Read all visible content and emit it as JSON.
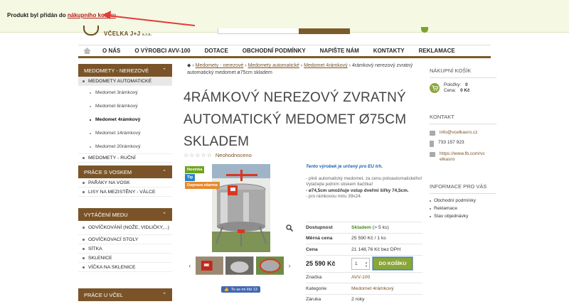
{
  "notice": {
    "text": "Produkt byl přidán do ",
    "link": "nákupního košíku"
  },
  "header": {
    "logo": "VČELKA J+J",
    "logo_suffix": "s.r.o."
  },
  "nav": [
    "O NÁS",
    "O VÝROBCI AVV-100",
    "DOTACE",
    "OBCHODNÍ PODMÍNKY",
    "NAPIŠTE NÁM",
    "KONTAKTY",
    "REKLAMACE"
  ],
  "sidebar": {
    "medomety": {
      "title": "MEDOMETY - NEREZOVÉ",
      "active": "MEDOMETY AUTOMATICKÉ",
      "subitems": [
        "Medomet 3rámkový",
        "Medomet 6rámkový",
        "Medomet 4rámkový",
        "Medomet 14rámkový",
        "Medomet 20rámkový"
      ],
      "after": "MEDOMETY - RUČNÍ"
    },
    "vosk": {
      "title": "PRÁCE S VOSKEM",
      "items": [
        "PAŘÁKY NA VOSK",
        "LISY NA MEZISTĚNY - VÁLCE"
      ]
    },
    "med": {
      "title": "VYTÁČENÍ MEDU",
      "items": [
        "ODVÍČKOVÁNÍ (NOŽE, VIDLIČKY,...)",
        "ODVÍČKOVACÍ STOLY",
        "SÍTKA",
        "SKLENICE",
        "VÍČKA NA SKLENICE"
      ]
    },
    "vcely": {
      "title": "PRÁCE U VČEL"
    }
  },
  "breadcrumb": {
    "b1": "Medomety - nerezové",
    "b2": "Medomety automatické",
    "b3": "Medomet 4rámkový",
    "current": "4rámkový nerezový zvratný automatický medomet ø75cm skladem"
  },
  "product": {
    "title": "4RÁMKOVÝ NEREZOVÝ ZVRATNÝ AUTOMATICKÝ MEDOMET Ø75CM SKLADEM",
    "stars": "☆☆☆☆☆",
    "rating": "Neohodnoceno",
    "badges": {
      "novinka": "Novinka",
      "tip": "Tip",
      "doprava": "Doprava zdarma"
    },
    "eu": "Tento výrobek je určený pro EU trh.",
    "desc1": "- plně automatický medomet, za cenu poloautomatického! Vytáčejte jedním stiskem tlačítka!",
    "desc2": "- ø74,5cm umožňuje vstup dveřmi šířky 74,5cm.",
    "desc3": "- pro rámkovou míru 39x24.",
    "fb": "To se mi líbí 13",
    "params": {
      "dostupnost_k": "Dostupnost",
      "dostupnost_v": "Skladem",
      "dostupnost_extra": " (> 5 ks)",
      "merna_k": "Měrná cena",
      "merna_v": "25 590 Kč / 1 ks",
      "cena_k": "Cena",
      "cena_v": "21 148,76 Kč bez DPH",
      "price": "25 590 Kč",
      "qty": "1",
      "buy": "DO KOŠÍKU",
      "znacka_k": "Značka",
      "znacka_v": "AVV-100",
      "kategorie_k": "Kategorie",
      "kategorie_v": "Medomet 4rámkový",
      "zaruka_k": "Záruka",
      "zaruka_v": "2 roky"
    }
  },
  "right": {
    "cart_title": "NÁKUPNÍ KOŠÍK",
    "polozky": "Položky:",
    "polozky_v": "0",
    "cena": "Cena:",
    "cena_v": "0 Kč",
    "contact_title": "KONTAKT",
    "email": "info@vcelkasro.cz",
    "phone": "733 157 923",
    "fb1": "https://www.fb.com/vc",
    "fb2": "elkasro",
    "info_title": "INFORMACE PRO VÁS",
    "info": [
      "Obchodní podmínky",
      "Reklamace",
      "Stav objednávky"
    ]
  }
}
